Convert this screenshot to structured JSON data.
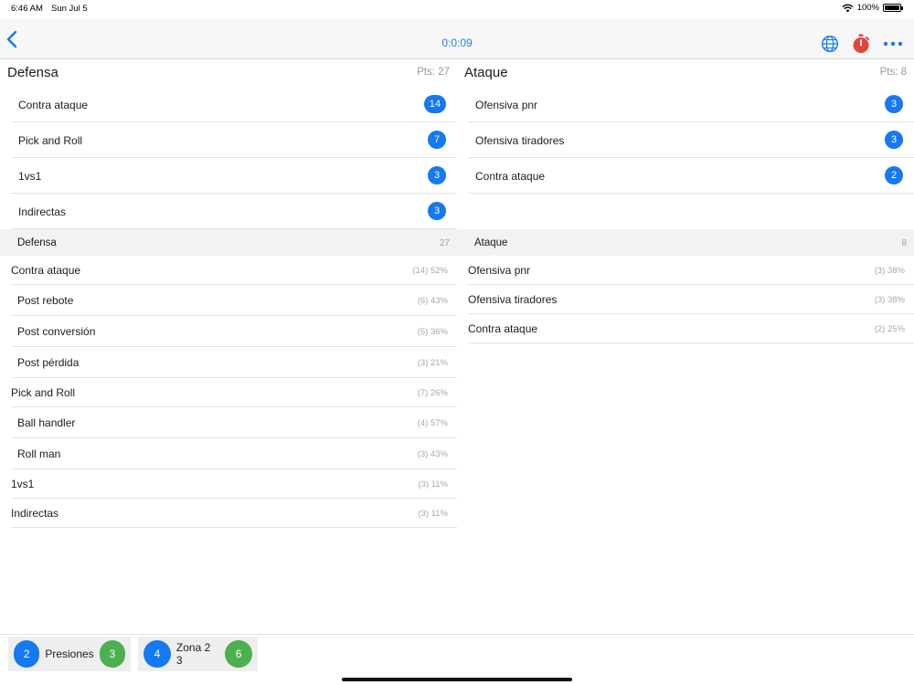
{
  "status": {
    "time": "6:46 AM",
    "date": "Sun Jul 5",
    "battery": "100%"
  },
  "nav": {
    "timer": "0:0:09",
    "back_icon": "chevron-left-icon",
    "globe_icon": "globe-icon",
    "stopwatch_icon": "stopwatch-icon",
    "more_icon": "ellipsis-icon",
    "accent": "#2b7de9"
  },
  "left": {
    "title": "Defensa",
    "pts": "Pts: 27",
    "counts": [
      {
        "label": "Contra ataque",
        "count": "14"
      },
      {
        "label": "Pick and Roll",
        "count": "7"
      },
      {
        "label": "1vs1",
        "count": "3"
      },
      {
        "label": "Indirectas",
        "count": "3"
      }
    ],
    "section": {
      "label": "Defensa",
      "value": "27"
    },
    "stats": [
      {
        "label": "Contra ataque",
        "value": "(14) 52%",
        "level": "main"
      },
      {
        "label": "Post rebote",
        "value": "(6) 43%",
        "level": "sub"
      },
      {
        "label": "Post conversión",
        "value": "(5) 36%",
        "level": "sub"
      },
      {
        "label": "Post pérdida",
        "value": "(3) 21%",
        "level": "sub"
      },
      {
        "label": "Pick and Roll",
        "value": "(7) 26%",
        "level": "main"
      },
      {
        "label": "Ball handler",
        "value": "(4) 57%",
        "level": "sub"
      },
      {
        "label": "Roll man",
        "value": "(3) 43%",
        "level": "sub"
      },
      {
        "label": "1vs1",
        "value": "(3) 11%",
        "level": "main"
      },
      {
        "label": "Indirectas",
        "value": "(3) 11%",
        "level": "main"
      }
    ]
  },
  "right": {
    "title": "Ataque",
    "pts": "Pts: 8",
    "counts": [
      {
        "label": "Ofensiva pnr",
        "count": "3"
      },
      {
        "label": "Ofensiva tiradores",
        "count": "3"
      },
      {
        "label": "Contra ataque",
        "count": "2"
      }
    ],
    "section": {
      "label": "Ataque",
      "value": "8"
    },
    "stats": [
      {
        "label": "Ofensiva pnr",
        "value": "(3) 38%",
        "level": "main"
      },
      {
        "label": "Ofensiva tiradores",
        "value": "(3) 38%",
        "level": "main"
      },
      {
        "label": "Contra ataque",
        "value": "(2) 25%",
        "level": "main"
      }
    ]
  },
  "bottom": {
    "chips": [
      {
        "left": "2",
        "name": "Presiones",
        "right": "3"
      },
      {
        "left": "4",
        "name": "Zona 2 3",
        "right": "6"
      }
    ]
  },
  "colors": {
    "badge": "#1479f2",
    "green": "#4caf50",
    "stopwatch": "#e0463a"
  }
}
